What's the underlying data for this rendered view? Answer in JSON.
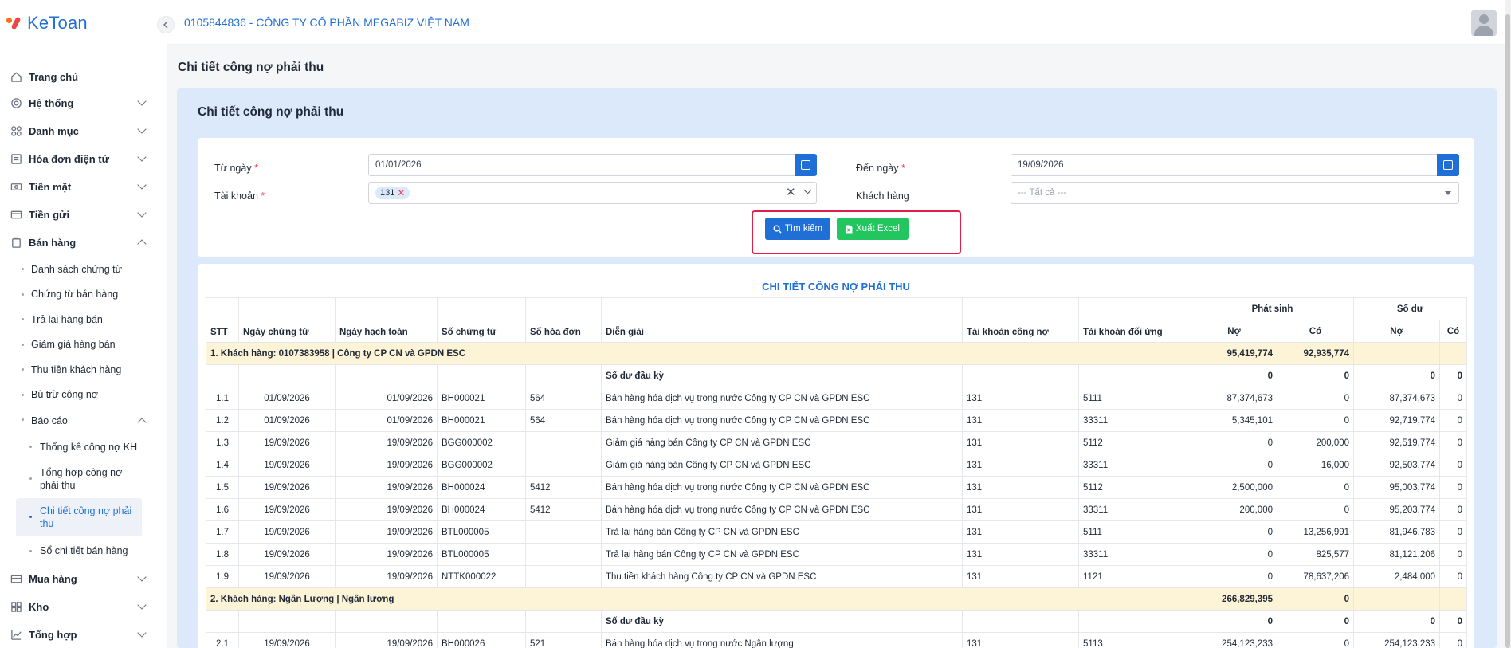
{
  "app": {
    "logo_text": "KeToan"
  },
  "header": {
    "company": "0105844836 - CÔNG TY CỔ PHẦN MEGABIZ VIỆT NAM"
  },
  "sidebar": {
    "items": [
      {
        "label": "Trang chủ",
        "icon": "home-icon"
      },
      {
        "label": "Hệ thống",
        "icon": "gear-icon"
      },
      {
        "label": "Danh mục",
        "icon": "grid-icon"
      },
      {
        "label": "Hóa đơn điện tử",
        "icon": "invoice-icon"
      },
      {
        "label": "Tiền mặt",
        "icon": "cash-icon"
      },
      {
        "label": "Tiền gửi",
        "icon": "card-icon"
      },
      {
        "label": "Bán hàng",
        "icon": "sales-icon"
      }
    ],
    "sales_sub": [
      "Danh sách chứng từ",
      "Chứng từ bán hàng",
      "Trả lại hàng bán",
      "Giảm giá hàng bán",
      "Thu tiền khách hàng",
      "Bù trừ công nợ",
      "Báo cáo"
    ],
    "report_sub": [
      "Thống kê công nợ KH",
      "Tổng hợp công nợ phải thu",
      "Chi tiết công nợ phải thu",
      "Sổ chi tiết bán hàng"
    ],
    "bottom_items": [
      {
        "label": "Mua hàng",
        "icon": "cart-icon"
      },
      {
        "label": "Kho",
        "icon": "warehouse-icon"
      },
      {
        "label": "Tổng hợp",
        "icon": "chart-icon"
      }
    ]
  },
  "page": {
    "title": "Chi tiết công nợ phải thu"
  },
  "panel": {
    "title": "Chi tiết công nợ phải thu"
  },
  "filters": {
    "from_label": "Từ ngày",
    "from_value": "01/01/2026",
    "to_label": "Đến ngày",
    "to_value": "19/09/2026",
    "account_label": "Tài khoản",
    "account_tag": "131",
    "customer_label": "Khách hàng",
    "customer_placeholder": "--- Tất cả ---",
    "required_mark": "*",
    "search_button": "Tìm kiếm",
    "excel_button": "Xuất Excel"
  },
  "report": {
    "title": "CHI TIẾT CÔNG NỢ PHẢI THU",
    "headers": {
      "stt": "STT",
      "ngay_ct": "Ngày chứng từ",
      "ngay_ht": "Ngày hạch toán",
      "so_ct": "Số chứng từ",
      "so_hd": "Số hóa đơn",
      "dien_giai": "Diễn giải",
      "tk_cn": "Tài khoản công nợ",
      "tk_du": "Tài khoản đối ứng",
      "phat_sinh": "Phát sinh",
      "so_du": "Số dư",
      "no": "Nợ",
      "co": "Có"
    },
    "opening_label": "Số dư đầu kỳ",
    "groups": [
      {
        "label": "1. Khách hàng: 0107383958 | Công ty CP CN và GPDN ESC",
        "ps_no": "95,419,774",
        "ps_co": "92,935,774",
        "opening": [
          "0",
          "0",
          "0",
          "0"
        ],
        "rows": [
          [
            "1.1",
            "01/09/2026",
            "01/09/2026",
            "BH000021",
            "564",
            "Bán hàng hóa dịch vụ trong nước Công ty CP CN và GPDN ESC",
            "131",
            "5111",
            "87,374,673",
            "0",
            "87,374,673",
            "0"
          ],
          [
            "1.2",
            "01/09/2026",
            "01/09/2026",
            "BH000021",
            "564",
            "Bán hàng hóa dịch vụ trong nước Công ty CP CN và GPDN ESC",
            "131",
            "33311",
            "5,345,101",
            "0",
            "92,719,774",
            "0"
          ],
          [
            "1.3",
            "19/09/2026",
            "19/09/2026",
            "BGG000002",
            "",
            "Giảm giá hàng bán Công ty CP CN và GPDN ESC",
            "131",
            "5112",
            "0",
            "200,000",
            "92,519,774",
            "0"
          ],
          [
            "1.4",
            "19/09/2026",
            "19/09/2026",
            "BGG000002",
            "",
            "Giảm giá hàng bán Công ty CP CN và GPDN ESC",
            "131",
            "33311",
            "0",
            "16,000",
            "92,503,774",
            "0"
          ],
          [
            "1.5",
            "19/09/2026",
            "19/09/2026",
            "BH000024",
            "5412",
            "Bán hàng hóa dịch vụ trong nước Công ty CP CN và GPDN ESC",
            "131",
            "5112",
            "2,500,000",
            "0",
            "95,003,774",
            "0"
          ],
          [
            "1.6",
            "19/09/2026",
            "19/09/2026",
            "BH000024",
            "5412",
            "Bán hàng hóa dịch vụ trong nước Công ty CP CN và GPDN ESC",
            "131",
            "33311",
            "200,000",
            "0",
            "95,203,774",
            "0"
          ],
          [
            "1.7",
            "19/09/2026",
            "19/09/2026",
            "BTL000005",
            "",
            "Trả lại hàng bán Công ty CP CN và GPDN ESC",
            "131",
            "5111",
            "0",
            "13,256,991",
            "81,946,783",
            "0"
          ],
          [
            "1.8",
            "19/09/2026",
            "19/09/2026",
            "BTL000005",
            "",
            "Trả lại hàng bán Công ty CP CN và GPDN ESC",
            "131",
            "33311",
            "0",
            "825,577",
            "81,121,206",
            "0"
          ],
          [
            "1.9",
            "19/09/2026",
            "19/09/2026",
            "NTTK000022",
            "",
            "Thu tiền khách hàng Công ty CP CN và GPDN ESC",
            "131",
            "1121",
            "0",
            "78,637,206",
            "2,484,000",
            "0"
          ]
        ]
      },
      {
        "label": "2. Khách hàng: Ngân Lượng | Ngân lượng",
        "ps_no": "266,829,395",
        "ps_co": "0",
        "opening": [
          "0",
          "0",
          "0",
          "0"
        ],
        "rows": [
          [
            "2.1",
            "19/09/2026",
            "19/09/2026",
            "BH000026",
            "521",
            "Bán hàng hóa dịch vụ trong nước Ngân lượng",
            "131",
            "5113",
            "254,123,233",
            "0",
            "254,123,233",
            "0"
          ]
        ]
      }
    ]
  },
  "colors": {
    "accent": "#1f6fd6",
    "success": "#22c55e",
    "group_row": "#fdf3d6",
    "panel_bg": "#dbe9fb",
    "highlight": "#e11d48"
  }
}
